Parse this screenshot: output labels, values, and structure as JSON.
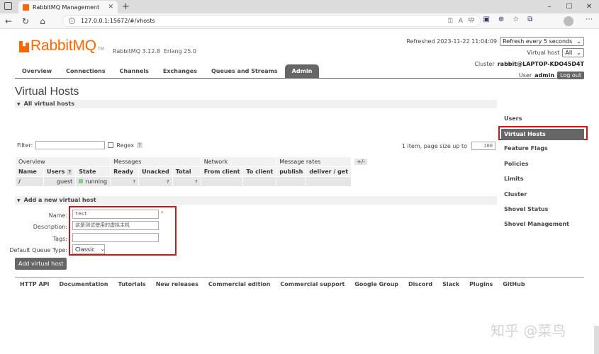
{
  "browser": {
    "tab_title": "RabbitMQ Management",
    "url": "127.0.0.1:15672/#/vhosts"
  },
  "header": {
    "brand": "RabbitMQ",
    "tm": "TM",
    "version": "RabbitMQ 3.12.8",
    "erlang": "Erlang 25.0",
    "refreshed": "Refreshed 2023-11-22 11:04:09",
    "refresh_select": "Refresh every 5 seconds",
    "vhost_label": "Virtual host",
    "vhost_select": "All",
    "cluster_label": "Cluster",
    "cluster_name": "rabbit@LAPTOP-KDO45D4T",
    "user_label": "User",
    "user_name": "admin",
    "logout": "Log out"
  },
  "nav": [
    "Overview",
    "Connections",
    "Channels",
    "Exchanges",
    "Queues and Streams",
    "Admin"
  ],
  "page_title": "Virtual Hosts",
  "all_vhosts": {
    "heading": "All virtual hosts",
    "filter_label": "Filter:",
    "regex_label": "Regex",
    "help": "?",
    "page_info": "1 item, page size up to",
    "page_size": "100",
    "table": {
      "groups": [
        "Overview",
        "Messages",
        "Network",
        "Message rates",
        "+/-"
      ],
      "columns": [
        "Name",
        "Users",
        "State",
        "Ready",
        "Unacked",
        "Total",
        "From client",
        "To client",
        "publish",
        "deliver / get"
      ],
      "users_help": "?",
      "row": {
        "name": "/",
        "users": "guest",
        "state": "running",
        "ready": "?",
        "unacked": "?",
        "total": "?"
      }
    }
  },
  "add_vhost": {
    "heading": "Add a new virtual host",
    "name_label": "Name:",
    "name_value": "test",
    "required": "*",
    "desc_label": "Description:",
    "desc_value": "这是测试使用的虚拟主机",
    "tags_label": "Tags:",
    "tags_value": "",
    "queue_type_label": "Default Queue Type:",
    "queue_type_value": "Classic",
    "submit": "Add virtual host"
  },
  "sidenav": [
    "Users",
    "Virtual Hosts",
    "Feature Flags",
    "Policies",
    "Limits",
    "Cluster",
    "Shovel Status",
    "Shovel Management"
  ],
  "footer": [
    "HTTP API",
    "Documentation",
    "Tutorials",
    "New releases",
    "Commercial edition",
    "Commercial support",
    "Google Group",
    "Discord",
    "Slack",
    "Plugins",
    "GitHub"
  ],
  "watermark": "知乎 @菜鸟",
  "colors": {
    "brand": "#ff6600",
    "highlight": "#c8161d",
    "nav_active": "#666666"
  }
}
